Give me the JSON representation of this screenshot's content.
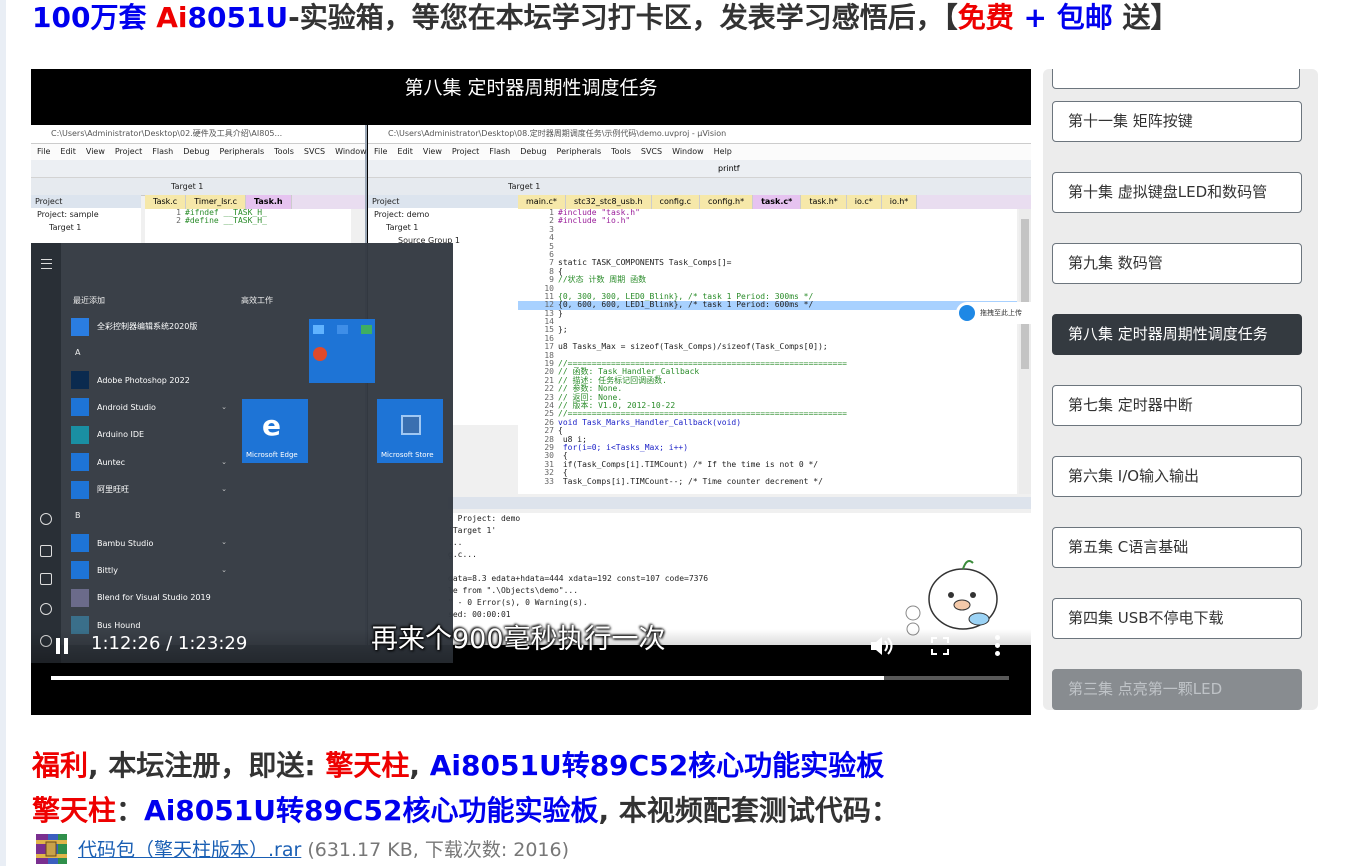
{
  "banner": {
    "part1": "100万套 ",
    "part2": "Ai",
    "part3": "8051U",
    "part4": "-实验箱，等您在本坛学习打卡区，发表学习感悟后，【",
    "part5": "免费",
    "part6": " + ",
    "part7": "包邮",
    "part8": " 送】"
  },
  "video": {
    "title": "第八集 定时器周期性调度任务",
    "subtitle": "再来个900毫秒执行一次",
    "time": "1:12:26 / 1:23:29",
    "progress_fraction": 0.87,
    "left_window_title": "C:\\Users\\Administrator\\Desktop\\02.硬件及工具介绍\\AI805...",
    "right_window_title": "C:\\Users\\Administrator\\Desktop\\08.定时器周期调度任务\\示例代码\\demo.uvproj - µVision",
    "menu_items": [
      "File",
      "Edit",
      "View",
      "Project",
      "Flash",
      "Debug",
      "Peripherals",
      "Tools",
      "SVCS",
      "Window",
      "Help"
    ],
    "target_label": "Target 1",
    "printf_label": "printf",
    "project_header": "Project",
    "left_tree": [
      "Project: sample",
      "Target 1"
    ],
    "right_tree": [
      "Project: demo",
      "Target 1",
      "Source Group 1"
    ],
    "left_tabs": [
      "Task.c",
      "Timer_lsr.c",
      "Task.h"
    ],
    "right_tabs": [
      "main.c*",
      "stc32_stc8_usb.h",
      "config.c",
      "config.h*",
      "task.c*",
      "task.h*",
      "io.c*",
      "io.h*"
    ],
    "left_code": [
      {
        "ln": "1",
        "text": "#ifndef __TASK_H_"
      },
      {
        "ln": "2",
        "text": "#define __TASK_H_"
      }
    ],
    "code_lines": [
      {
        "ln": "1",
        "text": "#include \"task.h\"",
        "cls": "str"
      },
      {
        "ln": "2",
        "text": "#include \"io.h\"",
        "cls": "str"
      },
      {
        "ln": "3",
        "text": ""
      },
      {
        "ln": "4",
        "text": ""
      },
      {
        "ln": "5",
        "text": ""
      },
      {
        "ln": "6",
        "text": ""
      },
      {
        "ln": "7",
        "text": "static TASK_COMPONENTS Task_Comps[]=",
        "cls": ""
      },
      {
        "ln": "8",
        "text": "{"
      },
      {
        "ln": "9",
        "text": "//状态  计数  周期  函数",
        "cls": "cmt"
      },
      {
        "ln": "10",
        "text": ""
      },
      {
        "ln": "11",
        "text": "{0, 300,  300,  LED0_Blink},     /* task 1 Period:  300ms */",
        "cls": "cmt"
      },
      {
        "ln": "12",
        "text": "{0, 600,  600,  LED1_Blink},     /* task 1 Period:  600ms */",
        "cls": "hl"
      },
      {
        "ln": "13",
        "text": "}"
      },
      {
        "ln": "14",
        "text": ""
      },
      {
        "ln": "15",
        "text": "};"
      },
      {
        "ln": "16",
        "text": ""
      },
      {
        "ln": "17",
        "text": "u8 Tasks_Max = sizeof(Task_Comps)/sizeof(Task_Comps[0]);"
      },
      {
        "ln": "18",
        "text": ""
      },
      {
        "ln": "19",
        "text": "//==========================================================",
        "cls": "cmt"
      },
      {
        "ln": "20",
        "text": "// 函数: Task_Handler_Callback",
        "cls": "cmt"
      },
      {
        "ln": "21",
        "text": "// 描述: 任务标记回调函数.",
        "cls": "cmt"
      },
      {
        "ln": "22",
        "text": "// 参数: None.",
        "cls": "cmt"
      },
      {
        "ln": "23",
        "text": "// 返回: None.",
        "cls": "cmt"
      },
      {
        "ln": "24",
        "text": "// 版本: V1.0, 2012-10-22",
        "cls": "cmt"
      },
      {
        "ln": "25",
        "text": "//==========================================================",
        "cls": "cmt"
      },
      {
        "ln": "26",
        "text": "void Task_Marks_Handler_Callback(void)",
        "cls": "kw"
      },
      {
        "ln": "27",
        "text": "{"
      },
      {
        "ln": "28",
        "text": "    u8 i;"
      },
      {
        "ln": "29",
        "text": "    for(i=0; i<Tasks_Max; i++)",
        "cls": "kw"
      },
      {
        "ln": "30",
        "text": "    {"
      },
      {
        "ln": "31",
        "text": "        if(Task_Comps[i].TIMCount)      /* If the time is not 0 */"
      },
      {
        "ln": "32",
        "text": "        {"
      },
      {
        "ln": "33",
        "text": "            Task_Comps[i].TIMCount--;   /* Time counter decrement */"
      }
    ],
    "build_output": [
      ": Project: demo",
      "'Target 1'",
      "...",
      "g.c...",
      "",
      "data=8.3 edata+hdata=444 xdata=192 const=107 code=7376",
      "le from \".\\Objects\\demo\"...",
      "\" - 0 Error(s), 0 Warning(s).",
      "sed:  00:00:01"
    ],
    "start_menu": {
      "recent_label": "最近添加",
      "productivity_label": "高效工作",
      "letter_a": "A",
      "letter_b": "B",
      "apps": [
        {
          "name": "全彩控制器编辑系统2020版",
          "color": "#2a7de1",
          "chev": ""
        },
        {
          "name": "Adobe Photoshop 2022",
          "color": "#0a2a4f",
          "chev": ""
        },
        {
          "name": "Android Studio",
          "color": "#1e74d6",
          "chev": "⌄"
        },
        {
          "name": "Arduino IDE",
          "color": "#1a8fa3",
          "chev": ""
        },
        {
          "name": "Auntec",
          "color": "#1e74d6",
          "chev": "⌄"
        },
        {
          "name": "阿里旺旺",
          "color": "#1e74d6",
          "chev": "⌄"
        }
      ],
      "apps_b": [
        {
          "name": "Bambu Studio",
          "color": "#1e74d6",
          "chev": "⌄"
        },
        {
          "name": "Bittly",
          "color": "#1e74d6",
          "chev": "⌄"
        },
        {
          "name": "Blend for Visual Studio 2019",
          "color": "#6b6b8a",
          "chev": ""
        },
        {
          "name": "Bus Hound",
          "color": "#3a6f8a",
          "chev": ""
        }
      ],
      "edge_label": "Microsoft Edge",
      "store_label": "Microsoft Store"
    },
    "share_label": "拖拽至此上传"
  },
  "episodes": [
    {
      "label": "第十一集 矩阵按键",
      "state": "normal"
    },
    {
      "label": "第十集 虚拟键盘LED和数码管",
      "state": "normal"
    },
    {
      "label": "第九集 数码管",
      "state": "normal"
    },
    {
      "label": "第八集 定时器周期性调度任务",
      "state": "active"
    },
    {
      "label": "第七集 定时器中断",
      "state": "normal"
    },
    {
      "label": "第六集 I/O输入输出",
      "state": "normal"
    },
    {
      "label": "第五集 C语言基础",
      "state": "normal"
    },
    {
      "label": "第四集 USB不停电下载",
      "state": "normal"
    },
    {
      "label": "第三集 点亮第一颗LED",
      "state": "faded"
    }
  ],
  "welfare": {
    "a": "福利",
    "b": ", 本坛注册，即送: ",
    "c": "擎天柱",
    "d": ", ",
    "e": "Ai8051U转89C52核心功能实验板"
  },
  "code_line": {
    "a": "擎天柱",
    "b": "：",
    "c": "Ai8051U转89C52核心功能实验板",
    "d": ", 本视频配套测试代码："
  },
  "download": {
    "link_text": "代码包（擎天柱版本）.rar",
    "meta_text": "(631.17 KB, 下载次数: 2016)"
  },
  "colors": {
    "blue": "#0000ee",
    "red": "#ee0000",
    "active_episode": "#343a40"
  }
}
